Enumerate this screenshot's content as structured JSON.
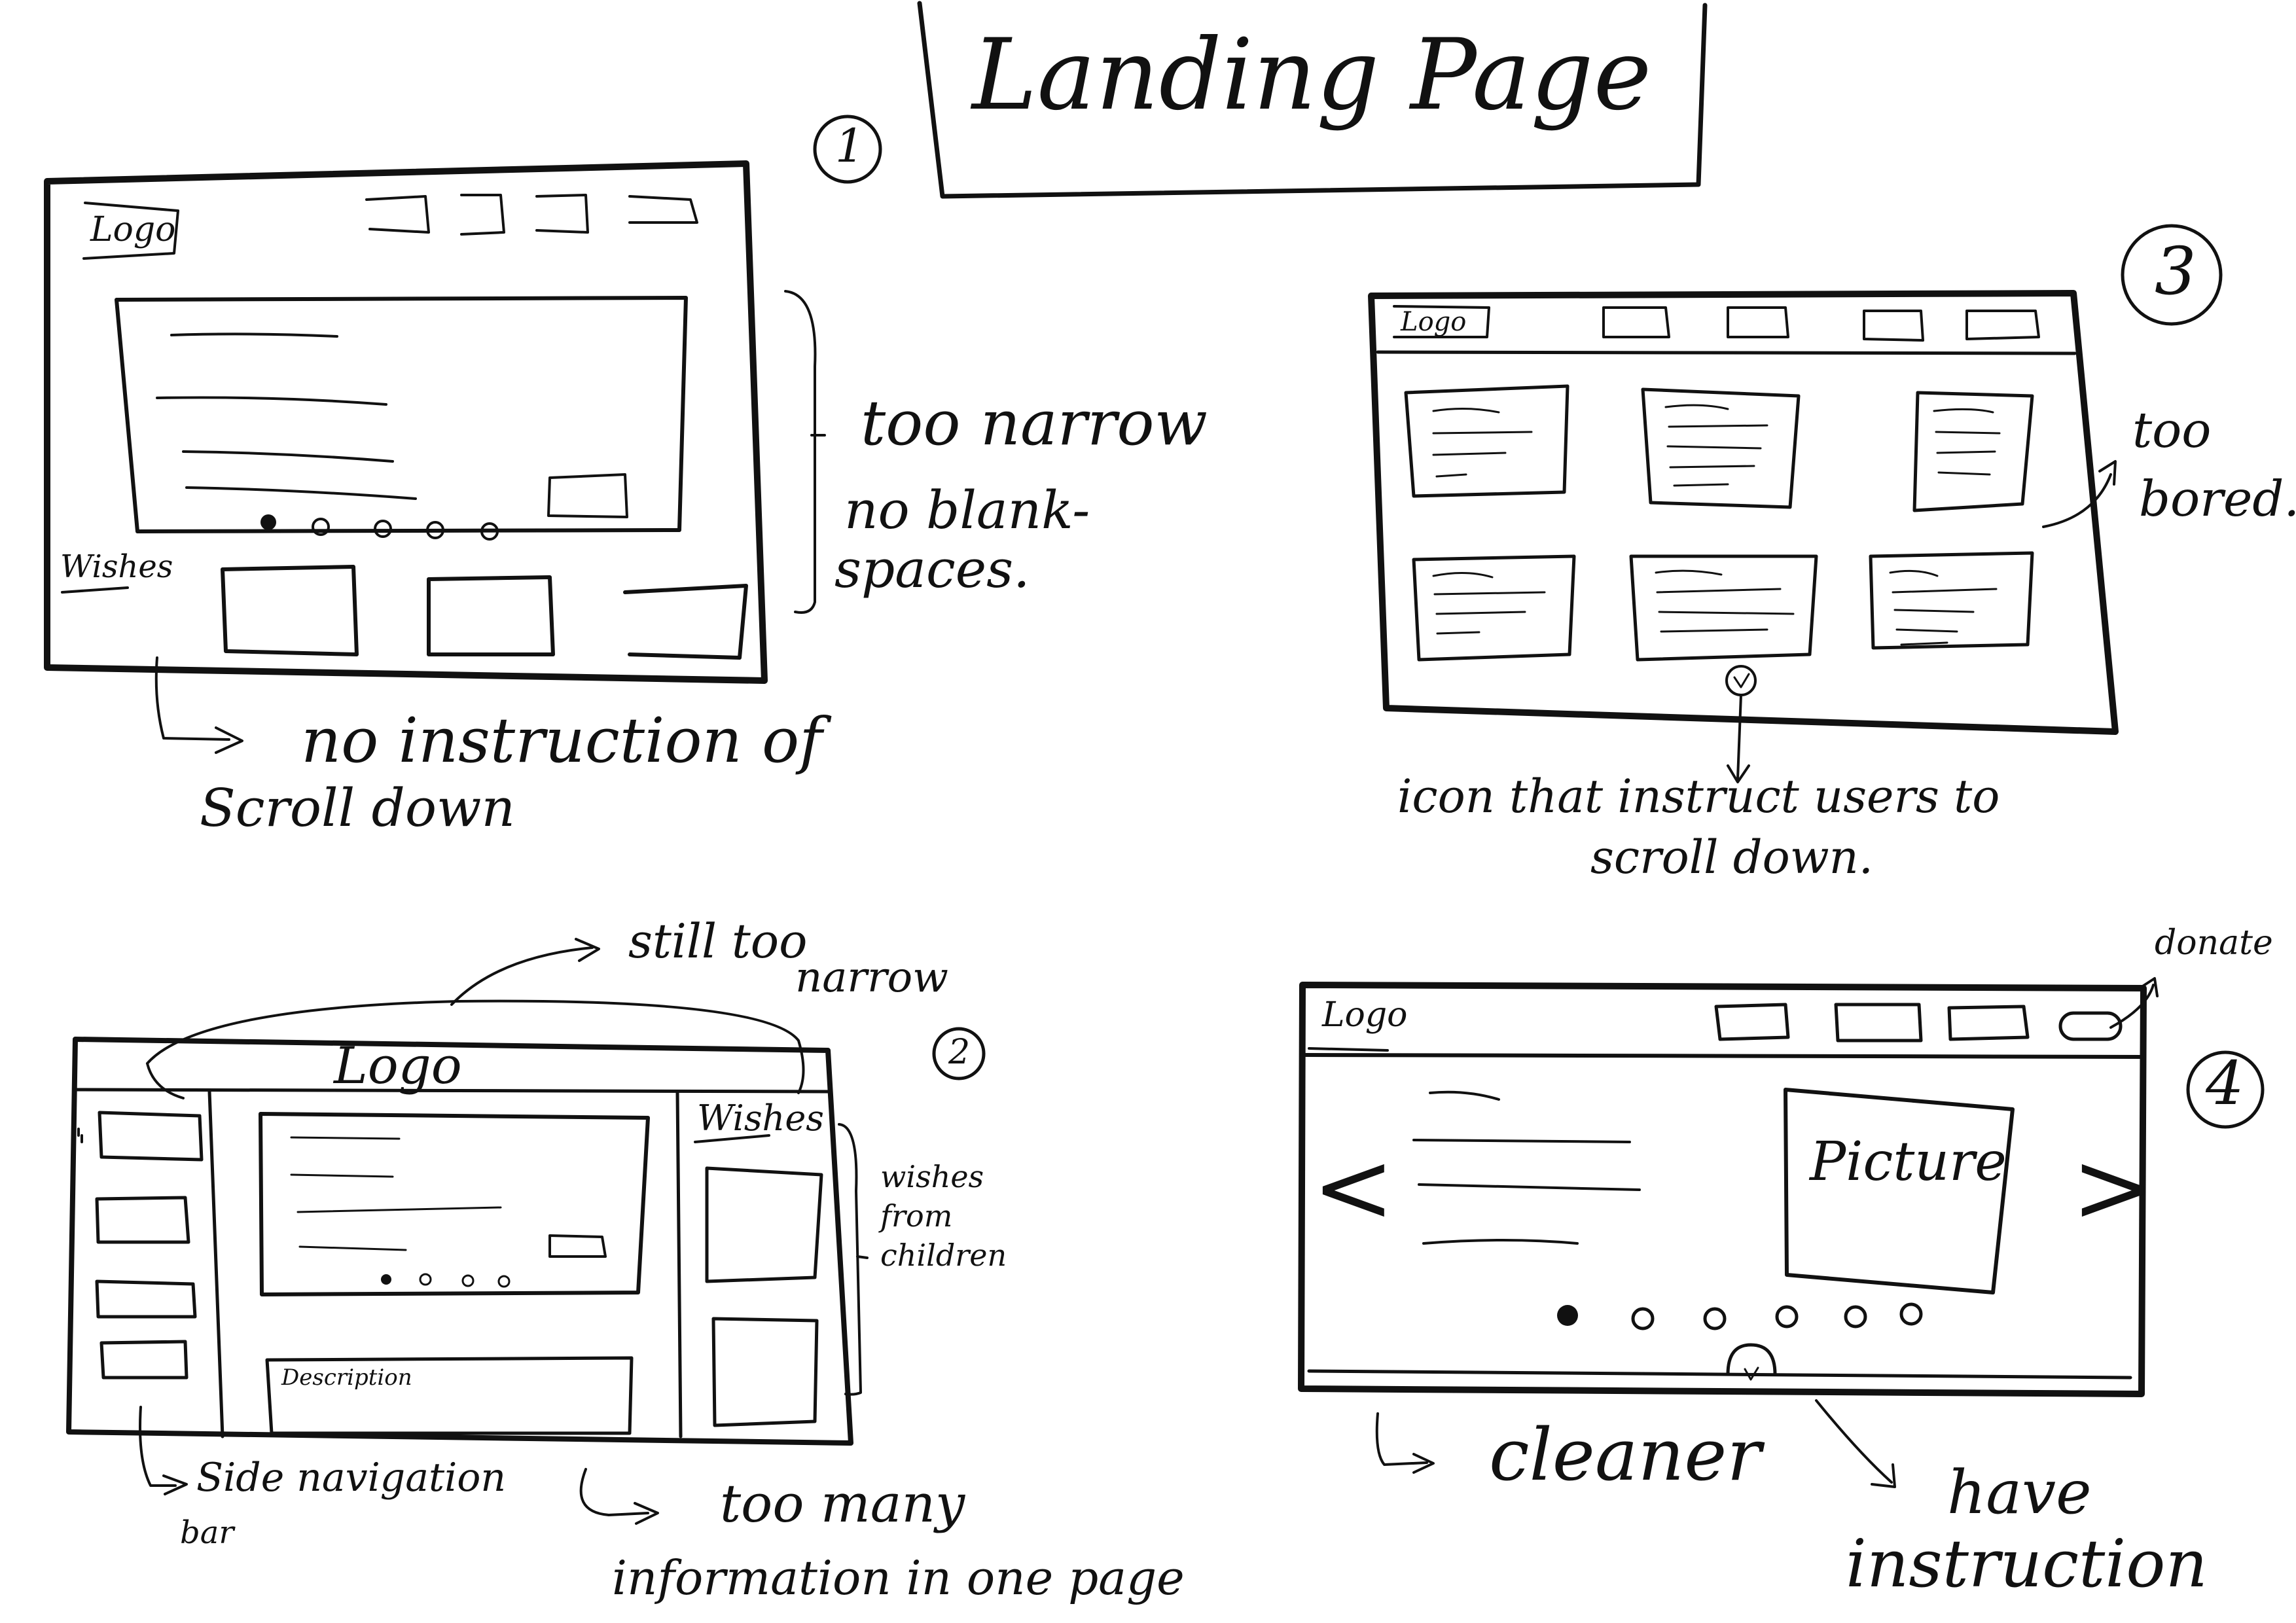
{
  "title": "Landing Page",
  "sketches": [
    {
      "number": "1",
      "logo": "Logo",
      "wishes_label": "Wishes",
      "notes": [
        "too narrow",
        "no blank-",
        "spaces."
      ],
      "comment_lines": [
        "no instruction of",
        "Scroll down"
      ]
    },
    {
      "number": "2",
      "logo": "Logo",
      "wishes_label": "Wishes",
      "description_label": "Description",
      "side_note": [
        "wishes",
        "from",
        "children"
      ],
      "top_note": [
        "still too",
        "narrow"
      ],
      "comment_nav": [
        "Side navigation",
        "bar"
      ],
      "comment_info": [
        "too many",
        "information in one page"
      ]
    },
    {
      "number": "3",
      "logo": "Logo",
      "note": [
        "too",
        "bored."
      ],
      "comment_lines": [
        "icon that instruct users to",
        "scroll down."
      ]
    },
    {
      "number": "4",
      "logo": "Logo",
      "picture_label": "Picture",
      "prev_glyph": "<",
      "next_glyph": ">",
      "donate_label": "donate",
      "comment_cleaner": "cleaner",
      "comment_instruction": [
        "have",
        "instruction"
      ]
    }
  ],
  "ink_color": "#111111"
}
